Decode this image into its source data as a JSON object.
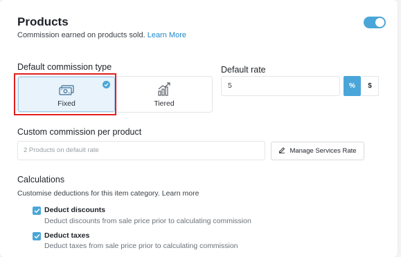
{
  "header": {
    "title": "Products",
    "subtitle": "Commission earned on products sold.",
    "learn_more": "Learn More",
    "toggle_on": true
  },
  "commission_type": {
    "label": "Default commission type",
    "options": [
      {
        "label": "Fixed",
        "icon": "cash-icon",
        "selected": true
      },
      {
        "label": "Tiered",
        "icon": "bar-chart-icon",
        "selected": false
      }
    ]
  },
  "default_rate": {
    "label": "Default rate",
    "value": "5",
    "units": [
      "%",
      "$"
    ],
    "selected_unit": "%"
  },
  "custom_commission": {
    "label": "Custom commission per product",
    "placeholder": "2 Products on default rate",
    "manage_button": "Manage Services Rate"
  },
  "calculations": {
    "label": "Calculations",
    "description": "Customise deductions for this item category. Learn more",
    "items": [
      {
        "title": "Deduct discounts",
        "description": "Deduct discounts from sale price prior to calculating commission",
        "checked": true
      },
      {
        "title": "Deduct taxes",
        "description": "Deduct taxes from sale price prior to calculating commission",
        "checked": true
      }
    ]
  },
  "colors": {
    "accent": "#4aa6d8",
    "link": "#1d87c9",
    "highlight": "#e01e1e"
  }
}
